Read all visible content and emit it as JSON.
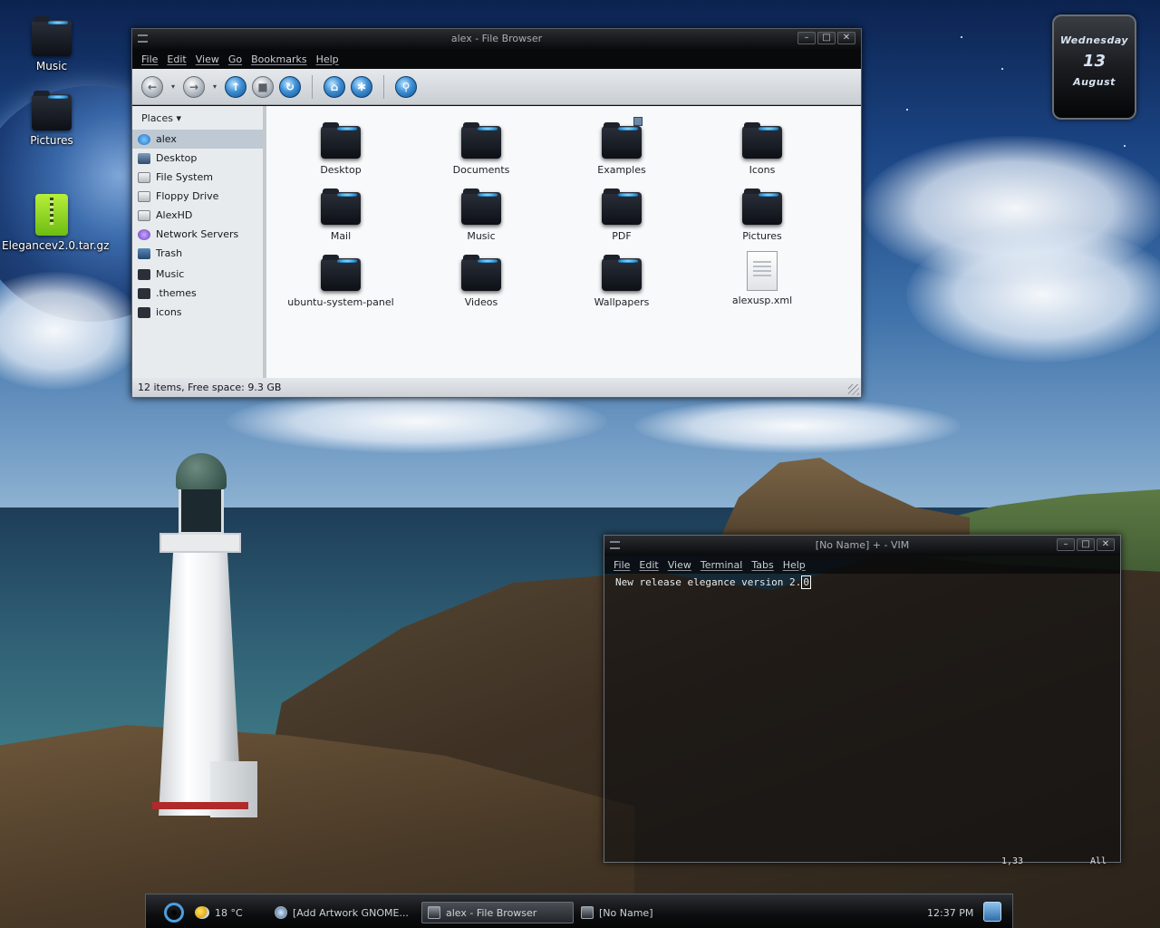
{
  "desktop": {
    "icons": [
      {
        "label": "Music",
        "icon": "dark-folder-icon"
      },
      {
        "label": "Pictures",
        "icon": "dark-folder-icon"
      },
      {
        "label": "Elegancev2.0.tar.gz",
        "icon": "archive-icon"
      }
    ]
  },
  "calendar": {
    "day": "Wednesday",
    "date": "13",
    "month": "August"
  },
  "file_browser": {
    "title": "alex - File Browser",
    "window_buttons": [
      "–",
      "□",
      "✕"
    ],
    "menu": [
      "File",
      "Edit",
      "View",
      "Go",
      "Bookmarks",
      "Help"
    ],
    "toolbar": {
      "back": "←",
      "forward": "→",
      "up": "↑",
      "stop": "■",
      "reload": "↻",
      "home": "⌂",
      "computer": "✱",
      "search": "⚲",
      "dropdown": "▾"
    },
    "places_header": "Places ▾",
    "places": [
      {
        "label": "alex",
        "icon": "home-icon"
      },
      {
        "label": "Desktop",
        "icon": "desktop-icon"
      },
      {
        "label": "File System",
        "icon": "drive-icon"
      },
      {
        "label": "Floppy Drive",
        "icon": "floppy-icon"
      },
      {
        "label": "AlexHD",
        "icon": "harddisk-icon"
      },
      {
        "label": "Network Servers",
        "icon": "network-icon"
      },
      {
        "label": "Trash",
        "icon": "trash-icon"
      },
      {
        "label": "Music",
        "icon": "folder-icon"
      },
      {
        "label": ".themes",
        "icon": "folder-icon"
      },
      {
        "label": "icons",
        "icon": "folder-icon"
      }
    ],
    "files": [
      {
        "name": "Desktop",
        "type": "folder"
      },
      {
        "name": "Documents",
        "type": "folder"
      },
      {
        "name": "Examples",
        "type": "folder"
      },
      {
        "name": "Icons",
        "type": "folder"
      },
      {
        "name": "Mail",
        "type": "folder"
      },
      {
        "name": "Music",
        "type": "folder"
      },
      {
        "name": "PDF",
        "type": "folder"
      },
      {
        "name": "Pictures",
        "type": "folder"
      },
      {
        "name": "ubuntu-system-panel",
        "type": "folder"
      },
      {
        "name": "Videos",
        "type": "folder"
      },
      {
        "name": "Wallpapers",
        "type": "folder"
      },
      {
        "name": "alexusp.xml",
        "type": "document"
      }
    ],
    "status": "12 items, Free space: 9.3 GB"
  },
  "vim": {
    "title": "[No Name] + - VIM",
    "window_buttons": [
      "–",
      "□",
      "✕"
    ],
    "menu": [
      "File",
      "Edit",
      "View",
      "Terminal",
      "Tabs",
      "Help"
    ],
    "text_before_cursor": "New release elegance version 2.",
    "text_cursor_char": "0",
    "position": "1,33",
    "scroll": "All"
  },
  "taskbar": {
    "weather": "18 °C",
    "tasks": [
      {
        "label": "[Add Artwork GNOME...",
        "active": false
      },
      {
        "label": "alex - File Browser",
        "active": true
      },
      {
        "label": "[No Name]",
        "active": false
      }
    ],
    "clock": "12:37 PM"
  }
}
